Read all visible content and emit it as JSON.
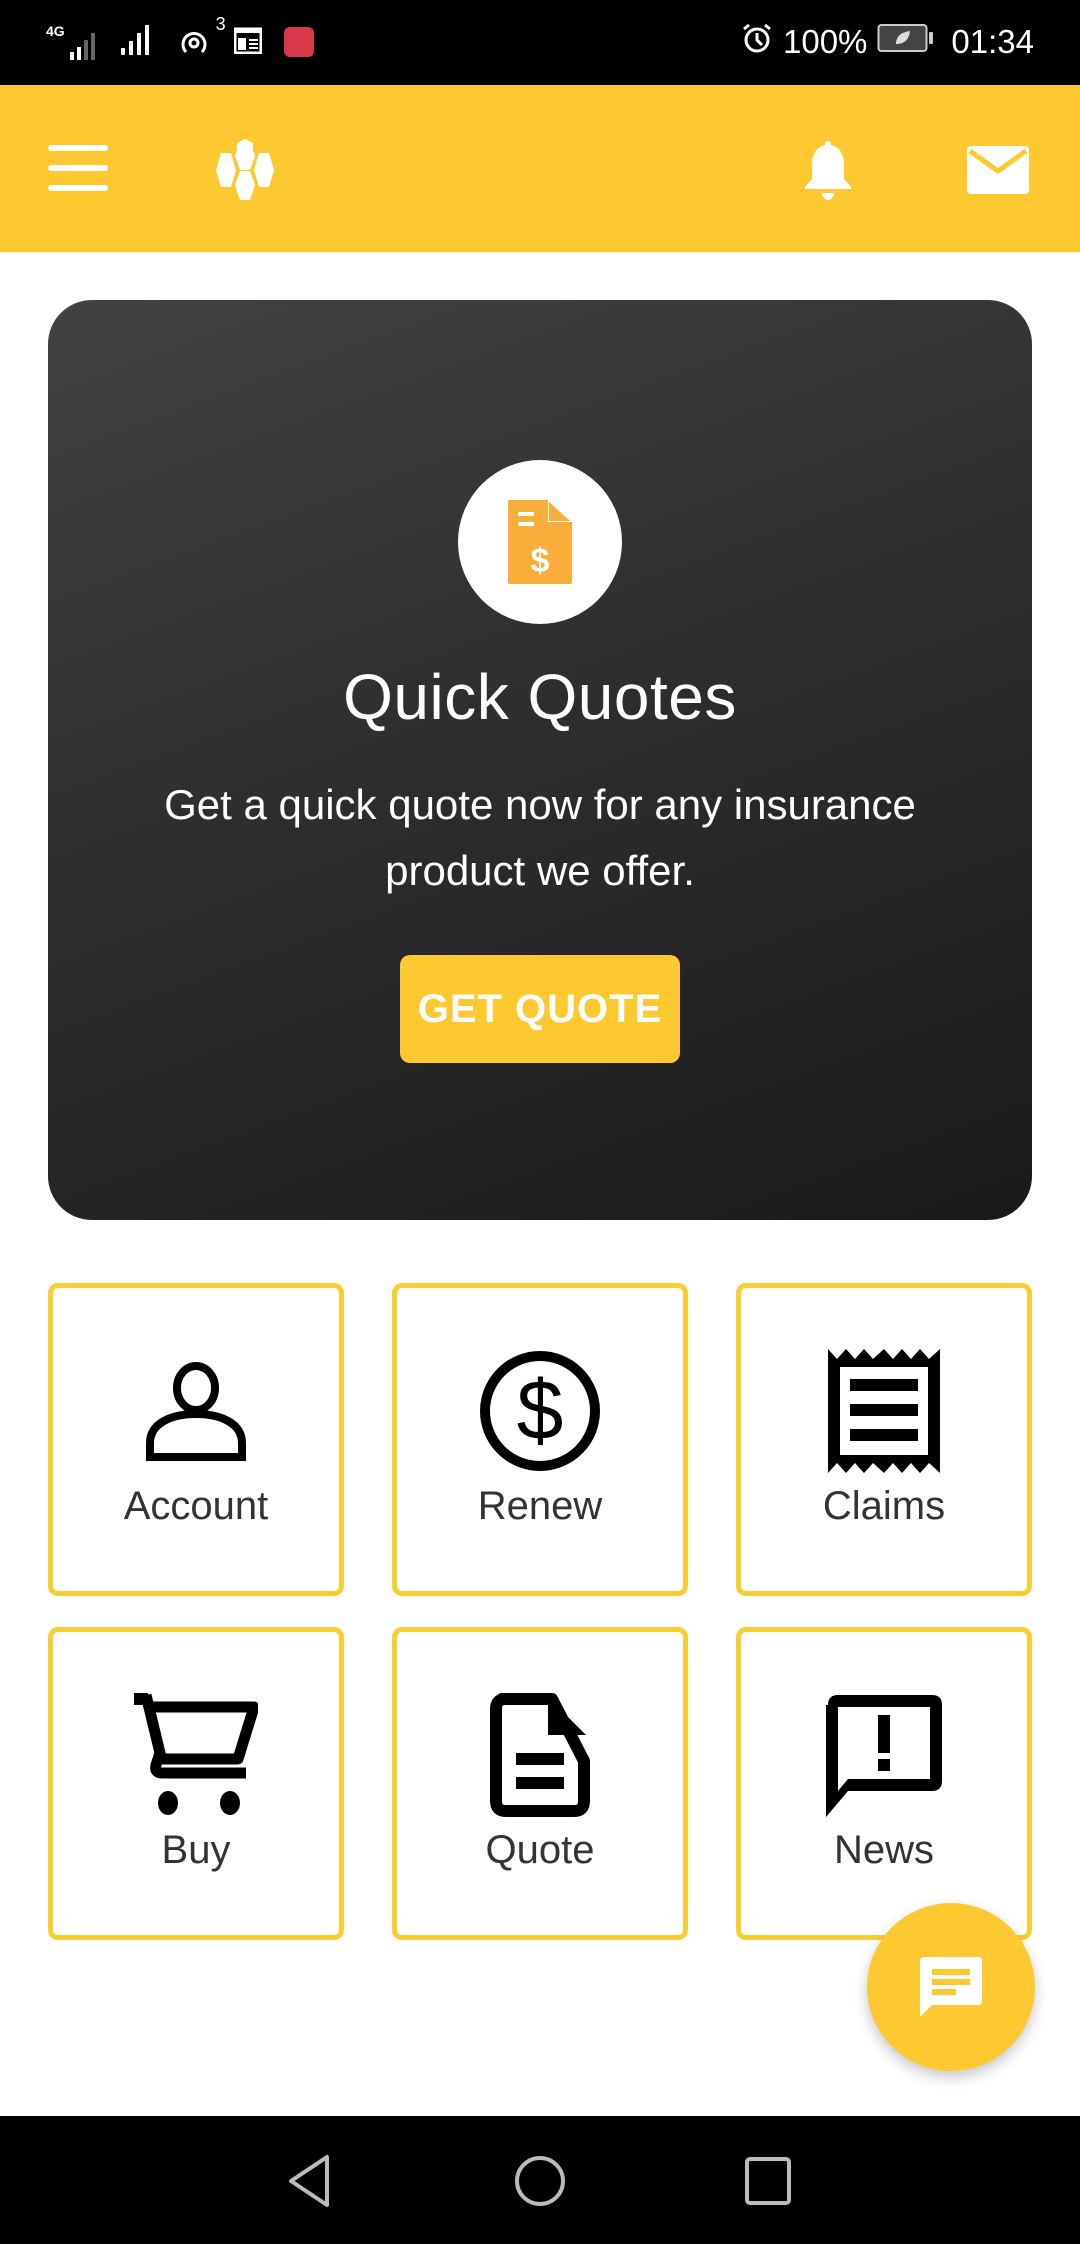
{
  "status_bar": {
    "network_type": "4G",
    "notification_count": "3",
    "battery_percent": "100%",
    "time": "01:34",
    "icons": [
      "signal-4g-icon",
      "signal-icon",
      "hotspot-icon",
      "calendar-icon",
      "huawei-app-icon",
      "alarm-icon",
      "battery-saver-icon"
    ]
  },
  "app_bar": {
    "menu_icon": "hamburger-menu-icon",
    "logo_icon": "honeycomb-logo-icon",
    "notifications_icon": "bell-icon",
    "messages_icon": "mail-icon",
    "background_color": "#fdc830"
  },
  "hero": {
    "icon": "quote-document-dollar-icon",
    "title": "Quick Quotes",
    "description": "Get a quick quote now for any insurance product we offer.",
    "button_label": "GET QUOTE",
    "accent_color": "#f9ae3b"
  },
  "tiles": [
    {
      "label": "Account",
      "icon": "person-icon"
    },
    {
      "label": "Renew",
      "icon": "dollar-circle-icon"
    },
    {
      "label": "Claims",
      "icon": "receipt-icon"
    },
    {
      "label": "Buy",
      "icon": "shopping-cart-icon"
    },
    {
      "label": "Quote",
      "icon": "document-icon"
    },
    {
      "label": "News",
      "icon": "announcement-icon"
    }
  ],
  "fab": {
    "icon": "chat-icon"
  },
  "nav_bar": {
    "back": "back-icon",
    "home": "home-icon",
    "recents": "recents-icon"
  }
}
